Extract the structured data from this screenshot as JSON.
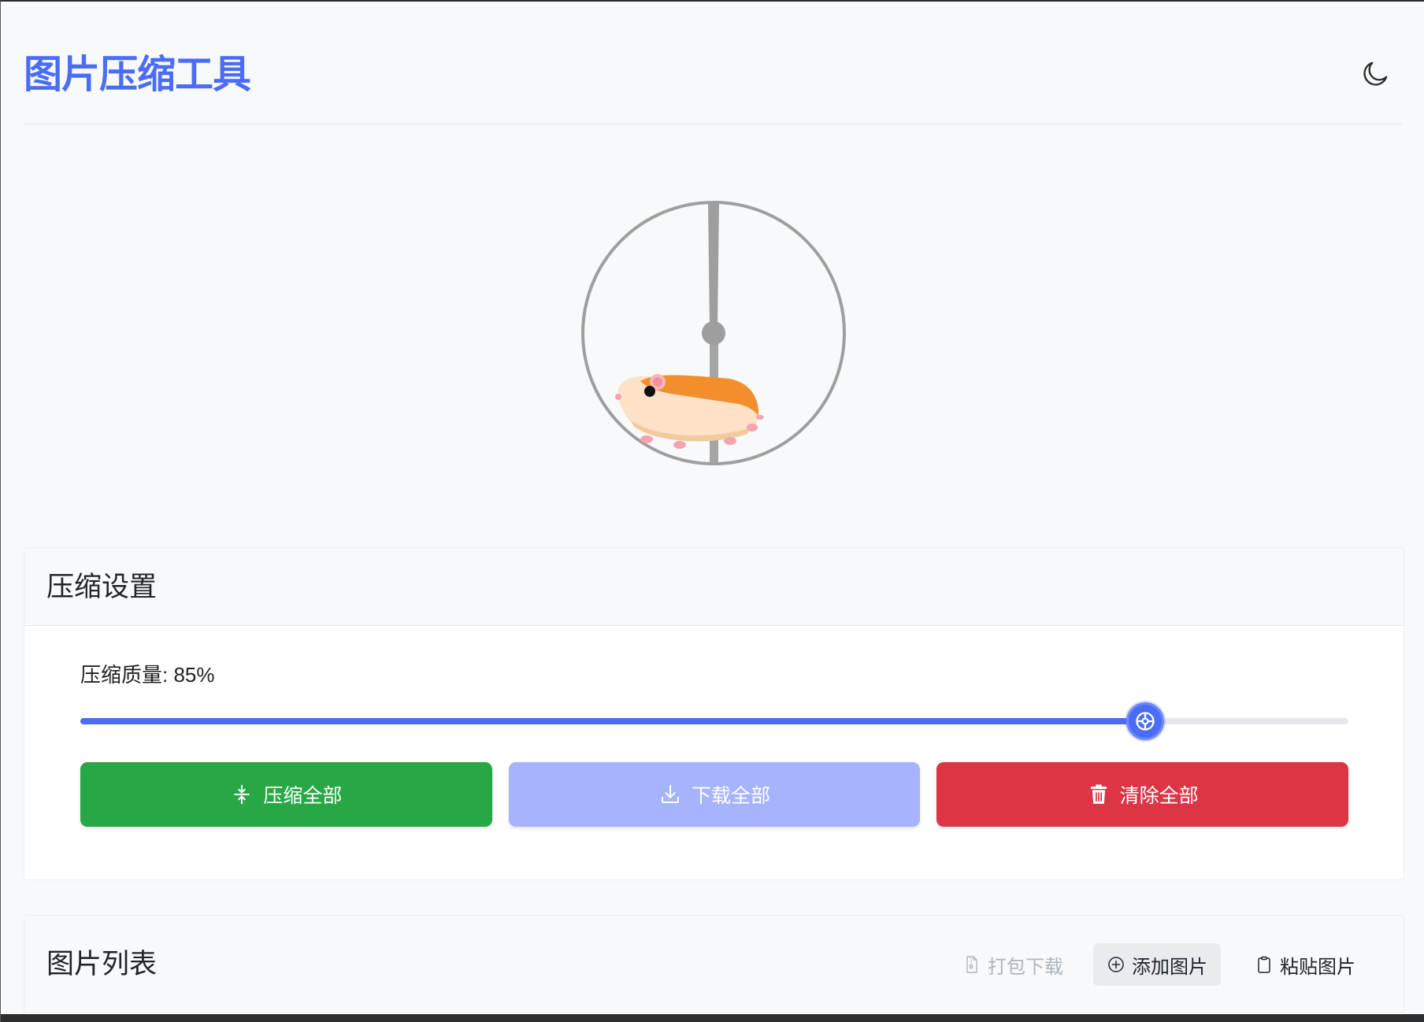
{
  "header": {
    "title": "图片压缩工具",
    "theme_toggle_icon": "moon-icon"
  },
  "loader": {
    "icon": "hamster-wheel-icon"
  },
  "settings": {
    "title": "压缩设置",
    "quality_label": "压缩质量: 85%",
    "quality_percent": 85,
    "actions": [
      {
        "label": "压缩全部",
        "icon": "compress-icon",
        "color": "#28a745",
        "disabled": false
      },
      {
        "label": "下载全部",
        "icon": "download-icon",
        "color": "#a5b4fc",
        "disabled": true
      },
      {
        "label": "清除全部",
        "icon": "trash-icon",
        "color": "#dc3545",
        "disabled": false
      }
    ]
  },
  "image_list": {
    "title": "图片列表",
    "actions": [
      {
        "label": "打包下载",
        "icon": "zip-file-icon",
        "disabled": true
      },
      {
        "label": "添加图片",
        "icon": "plus-circle-icon",
        "disabled": false
      },
      {
        "label": "粘贴图片",
        "icon": "clipboard-icon",
        "disabled": false
      }
    ]
  },
  "colors": {
    "accent": "#4a6cf7",
    "page_background": "#f8f9fa",
    "slider_track": "#e5e7eb"
  }
}
